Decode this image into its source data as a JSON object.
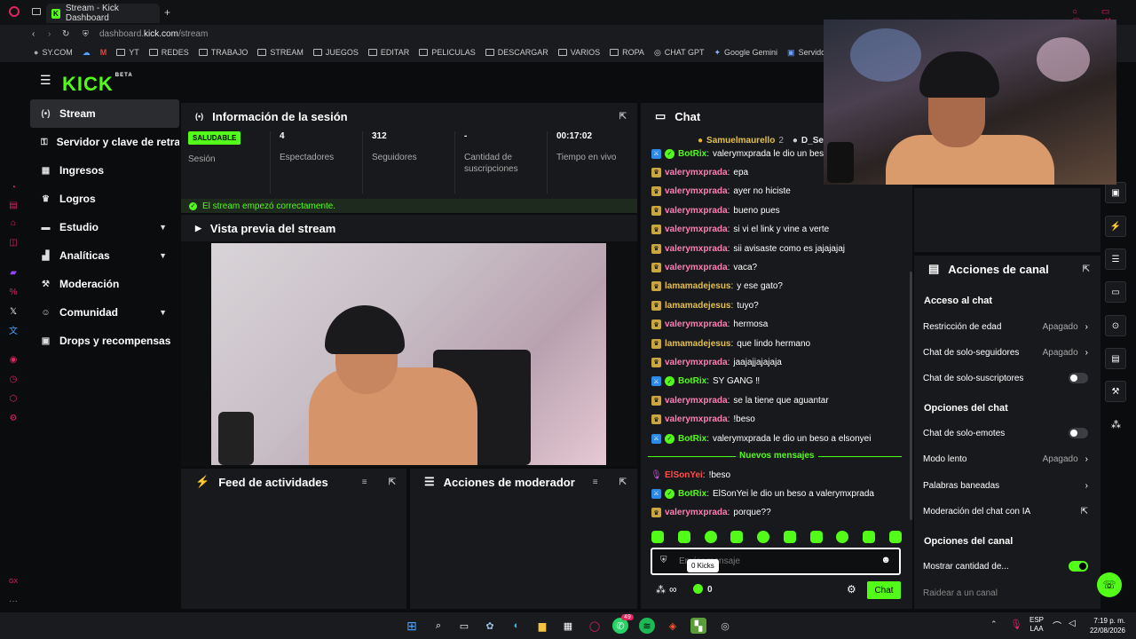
{
  "browser": {
    "tab_title": "Stream - Kick Dashboard",
    "url_host": "dashboard.",
    "url_domain": "kick.com",
    "url_path": "/stream",
    "bookmarks": [
      "SY.COM",
      "YT",
      "REDES",
      "TRABAJO",
      "STREAM",
      "JUEGOS",
      "EDITAR",
      "PELICULAS",
      "DESCARGAR",
      "VARIOS",
      "ROPA",
      "CHAT GPT",
      "Google Gemini",
      "Servidor | Aternos..."
    ]
  },
  "brand": {
    "logo": "KICK",
    "beta": "BETA",
    "accent": "#53fc18"
  },
  "nav": [
    {
      "label": "Stream",
      "icon": "stream-icon"
    },
    {
      "label": "Servidor y clave de retransmisión",
      "icon": "key-icon"
    },
    {
      "label": "Ingresos",
      "icon": "revenue-icon"
    },
    {
      "label": "Logros",
      "icon": "trophy-icon"
    },
    {
      "label": "Estudio",
      "icon": "studio-icon",
      "expand": true
    },
    {
      "label": "Analíticas",
      "icon": "analytics-icon",
      "expand": true
    },
    {
      "label": "Moderación",
      "icon": "moderation-icon"
    },
    {
      "label": "Comunidad",
      "icon": "community-icon",
      "expand": true
    },
    {
      "label": "Drops y recompensas",
      "icon": "drops-icon"
    }
  ],
  "session": {
    "title": "Información de la sesión",
    "status": "SALUDABLE",
    "status_label": "Sesión",
    "viewers": "4",
    "viewers_label": "Espectadores",
    "followers": "312",
    "followers_label": "Seguidores",
    "subs": "-",
    "subs_label_1": "Cantidad de",
    "subs_label_2": "suscripciones",
    "uptime": "00:17:02",
    "uptime_label": "Tiempo en vivo",
    "notice": "El stream empezó correctamente."
  },
  "preview": {
    "title": "Vista previa del stream"
  },
  "activity": {
    "title": "Feed de actividades"
  },
  "modactions": {
    "title": "Acciones de moderador"
  },
  "chat": {
    "title": "Chat",
    "top_users": [
      {
        "name": "Samuelmaurello",
        "count": "2"
      },
      {
        "name": "D_Se"
      }
    ],
    "messages": [
      {
        "user": "BotRix",
        "text": "valerymxprada le dio un beso",
        "type": "bot"
      },
      {
        "user": "valerymxprada",
        "text": "epa",
        "type": "sub"
      },
      {
        "user": "valerymxprada",
        "text": "ayer no hiciste",
        "type": "sub"
      },
      {
        "user": "valerymxprada",
        "text": "bueno pues",
        "type": "sub"
      },
      {
        "user": "valerymxprada",
        "text": "si vi el link y vine a verte",
        "type": "sub"
      },
      {
        "user": "valerymxprada",
        "text": "sii avisaste como es jajajajaj",
        "type": "sub"
      },
      {
        "user": "valerymxprada",
        "text": "vaca?",
        "type": "sub"
      },
      {
        "user": "lamamadejesus",
        "text": "y ese gato?",
        "type": "sub2"
      },
      {
        "user": "lamamadejesus",
        "text": "tuyo?",
        "type": "sub2"
      },
      {
        "user": "valerymxprada",
        "text": "hermosa",
        "type": "sub"
      },
      {
        "user": "lamamadejesus",
        "text": "que lindo hermano",
        "type": "sub2"
      },
      {
        "user": "valerymxprada",
        "text": "jaajajjajajaja",
        "type": "sub"
      },
      {
        "user": "BotRix",
        "text": "SY GANG ‼",
        "type": "bot"
      },
      {
        "user": "valerymxprada",
        "text": "se la tiene que aguantar",
        "type": "sub"
      },
      {
        "user": "valerymxprada",
        "text": "!beso",
        "type": "sub"
      },
      {
        "user": "BotRix",
        "text": "valerymxprada le dio un beso a elsonyei",
        "type": "bot"
      }
    ],
    "new_messages_label": "Nuevos mensajes",
    "new_messages": [
      {
        "user": "ElSonYei",
        "text": "!beso",
        "type": "mic"
      },
      {
        "user": "BotRix",
        "text": "ElSonYei le dio un beso a valerymxprada",
        "type": "bot"
      },
      {
        "user": "valerymxprada",
        "text": "porque??",
        "type": "sub"
      }
    ],
    "input_placeholder": "Enviar mensaje",
    "tooltip": "0 Kicks",
    "kicks_count": "0",
    "send_label": "Chat"
  },
  "channel_actions": {
    "title": "Acciones de canal",
    "chat_access": "Acceso al chat",
    "age_restriction": "Restricción de edad",
    "age_value": "Apagado",
    "followers_only": "Chat de solo-seguidores",
    "followers_value": "Apagado",
    "subs_only": "Chat de solo-suscriptores",
    "chat_options": "Opciones del chat",
    "emotes_only": "Chat de solo-emotes",
    "slow_mode": "Modo lento",
    "slow_value": "Apagado",
    "banned_words": "Palabras baneadas",
    "ai_moderation": "Moderación del chat con IA",
    "channel_options": "Opciones del canal",
    "show_count": "Mostrar cantidad de...",
    "raid": "Raidear a un canal"
  },
  "taskbar": {
    "lang": "ESP",
    "lang2": "LAA",
    "time": "7:19 p. m.",
    "date": "22/08/2026",
    "whatsapp_badge": "49"
  }
}
